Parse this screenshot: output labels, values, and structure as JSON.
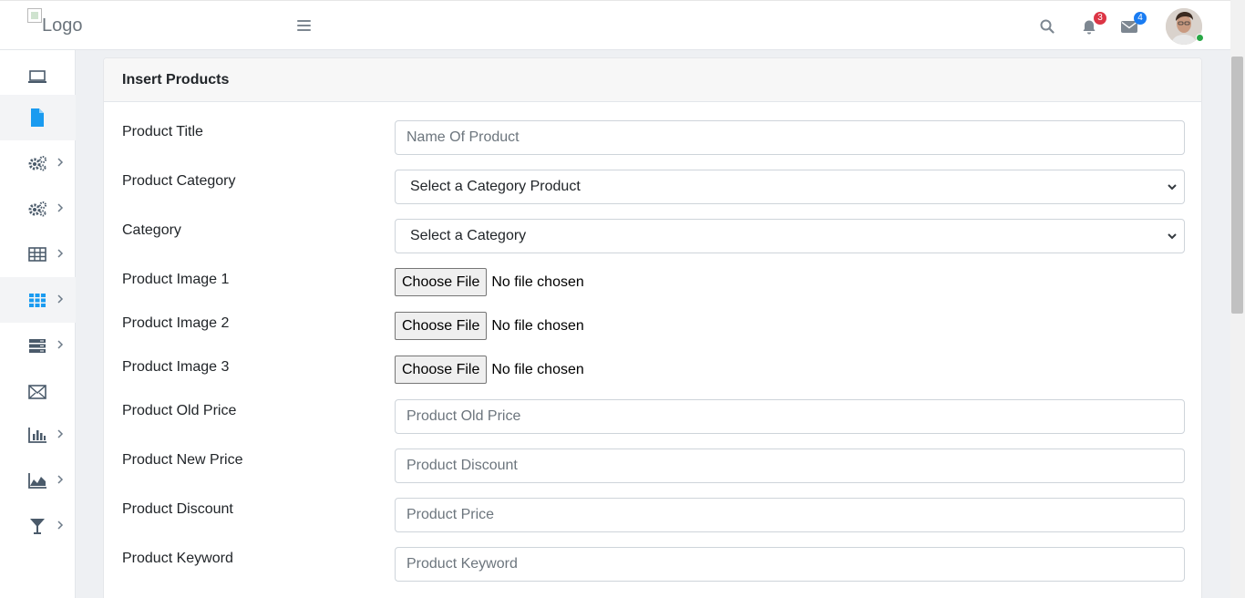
{
  "header": {
    "logo_alt": "Logo",
    "notifications_count": "3",
    "messages_count": "4",
    "colors": {
      "notif_badge": "#dc3545",
      "msg_badge": "#1a7cf2",
      "online": "#28a745",
      "icon": "#7d8791"
    }
  },
  "sidebar": {
    "items": [
      {
        "icon": "laptop-icon",
        "has_submenu": false,
        "active": false
      },
      {
        "icon": "file-icon",
        "has_submenu": false,
        "active": true
      },
      {
        "icon": "gears-icon",
        "has_submenu": true,
        "active": false
      },
      {
        "icon": "gears-icon",
        "has_submenu": true,
        "active": false
      },
      {
        "icon": "table-icon",
        "has_submenu": true,
        "active": false
      },
      {
        "icon": "grid-icon",
        "has_submenu": true,
        "active": true
      },
      {
        "icon": "server-icon",
        "has_submenu": true,
        "active": false
      },
      {
        "icon": "envelope-icon",
        "has_submenu": false,
        "active": false
      },
      {
        "icon": "bar-chart-icon",
        "has_submenu": true,
        "active": false
      },
      {
        "icon": "area-chart-icon",
        "has_submenu": true,
        "active": false
      },
      {
        "icon": "filter-icon",
        "has_submenu": true,
        "active": false
      }
    ],
    "colors": {
      "icon": "#4a5a6a",
      "active_icon": "#1a9bf0"
    }
  },
  "card": {
    "title": "Insert Products"
  },
  "form": {
    "title_label": "Product Title",
    "title_placeholder": "Name Of Product",
    "product_category_label": "Product Category",
    "product_category_value": "Select a Category Product",
    "category_label": "Category",
    "category_value": "Select a Category",
    "image1_label": "Product Image 1",
    "image2_label": "Product Image 2",
    "image3_label": "Product Image 3",
    "choose_file": "Choose File",
    "no_file": "No file chosen",
    "old_price_label": "Product Old Price",
    "old_price_placeholder": "Product Old Price",
    "new_price_label": "Product New Price",
    "new_price_placeholder": "Product Discount",
    "discount_label": "Product Discount",
    "discount_placeholder": "Product Price",
    "keyword_label": "Product Keyword",
    "keyword_placeholder": "Product Keyword"
  }
}
